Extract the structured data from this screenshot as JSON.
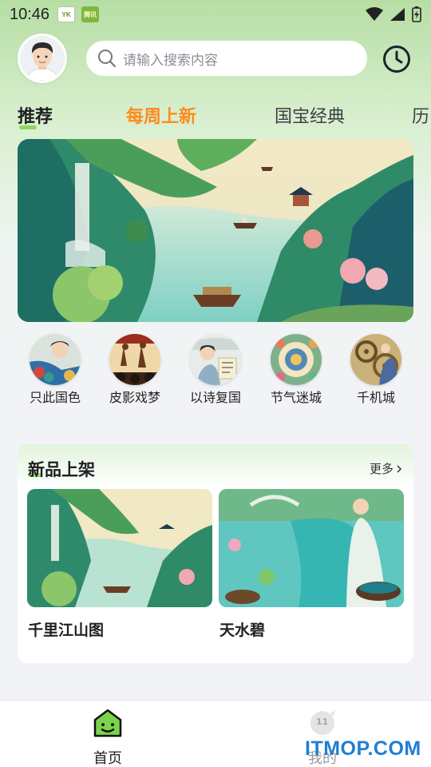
{
  "status_bar": {
    "time": "10:46",
    "app_icons": [
      "YK",
      "腾讯"
    ]
  },
  "header": {
    "search_placeholder": "请输入搜索内容"
  },
  "tabs": [
    {
      "label": "推荐",
      "active": true
    },
    {
      "label": "每周上新",
      "highlight": true
    },
    {
      "label": "国宝经典"
    },
    {
      "label": "历"
    }
  ],
  "categories": [
    {
      "label": "只此国色"
    },
    {
      "label": "皮影戏梦"
    },
    {
      "label": "以诗复国"
    },
    {
      "label": "节气迷城"
    },
    {
      "label": "千机城"
    }
  ],
  "new_products": {
    "title": "新品上架",
    "more_label": "更多",
    "items": [
      {
        "name": "千里江山图"
      },
      {
        "name": "天水碧"
      }
    ]
  },
  "bottom_nav": [
    {
      "label": "首页",
      "active": true
    },
    {
      "label": "我的",
      "badge": "11"
    }
  ],
  "watermark": "ITMOP.COM",
  "colors": {
    "accent_green": "#7bd44a",
    "highlight_orange": "#ff8a1d",
    "watermark_blue": "#1f7fd0"
  }
}
